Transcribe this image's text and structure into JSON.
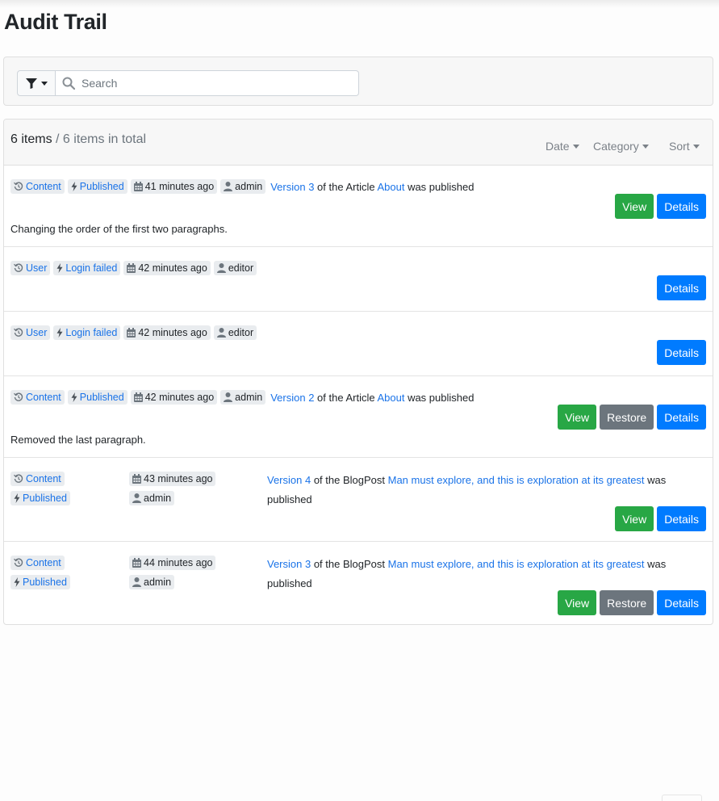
{
  "page": {
    "title": "Audit Trail"
  },
  "filter": {
    "search_placeholder": "Search",
    "filter_icon": "filter-icon"
  },
  "header": {
    "count": "6 items",
    "total": "/ 6 items in total",
    "date_label": "Date",
    "category_label": "Category",
    "sort_label": "Sort"
  },
  "colors": {
    "view": "#28a745",
    "restore": "#6c757d",
    "details": "#007bff",
    "link": "#1a73e8"
  },
  "buttons": {
    "view": "View",
    "restore": "Restore",
    "details": "Details"
  },
  "entries": [
    {
      "category": "Content",
      "event": "Published",
      "time": "41 minutes ago",
      "user": "admin",
      "version_link": "Version 3",
      "middle": " of the Article ",
      "target_link": "About",
      "suffix": " was published",
      "comment": "Changing the order of the first two paragraphs."
    },
    {
      "category": "User",
      "event": "Login failed",
      "time": "42 minutes ago",
      "user": "editor"
    },
    {
      "category": "User",
      "event": "Login failed",
      "time": "42 minutes ago",
      "user": "editor"
    },
    {
      "category": "Content",
      "event": "Published",
      "time": "42 minutes ago",
      "user": "admin",
      "version_link": "Version 2",
      "middle": " of the Article ",
      "target_link": "About",
      "suffix": " was published",
      "comment": "Removed the last paragraph."
    },
    {
      "category": "Content",
      "event": "Published",
      "time": "43 minutes ago",
      "user": "admin",
      "version_link": "Version 4",
      "middle": " of the BlogPost ",
      "target_link": "Man must explore, and this is exploration at its greatest",
      "suffix": " was published"
    },
    {
      "category": "Content",
      "event": "Published",
      "time": "44 minutes ago",
      "user": "admin",
      "version_link": "Version 3",
      "middle": " of the BlogPost ",
      "target_link": "Man must explore, and this is exploration at its greatest",
      "suffix": " was published"
    }
  ]
}
